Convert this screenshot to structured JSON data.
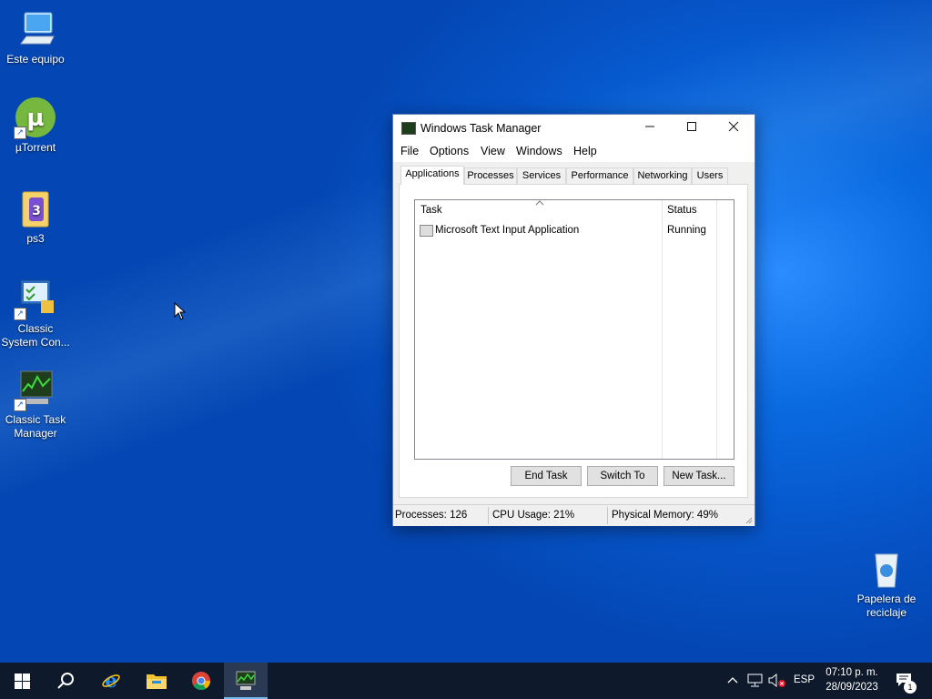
{
  "desktop": {
    "icons": [
      {
        "label": "Este equipo"
      },
      {
        "label": "µTorrent"
      },
      {
        "label": "ps3"
      },
      {
        "label": "Classic System Con..."
      },
      {
        "label": "Classic Task Manager"
      },
      {
        "label": "Papelera de reciclaje"
      }
    ]
  },
  "window": {
    "title": "Windows Task Manager",
    "menu": [
      "File",
      "Options",
      "View",
      "Windows",
      "Help"
    ],
    "tabs": [
      "Applications",
      "Processes",
      "Services",
      "Performance",
      "Networking",
      "Users"
    ],
    "active_tab": "Applications",
    "columns": {
      "task": "Task",
      "status": "Status"
    },
    "rows": [
      {
        "task": "Microsoft Text Input Application",
        "status": "Running"
      }
    ],
    "buttons": {
      "end_task": "End Task",
      "switch_to": "Switch To",
      "new_task": "New Task..."
    },
    "statusbar": {
      "processes": "Processes: 126",
      "cpu": "CPU Usage: 21%",
      "memory": "Physical Memory: 49%"
    }
  },
  "taskbar": {
    "items": [
      "start-icon",
      "search-icon",
      "internet-explorer-icon",
      "file-explorer-icon",
      "chrome-icon",
      "task-manager-icon"
    ],
    "tray": {
      "language": "ESP",
      "time": "07:10 p. m.",
      "date": "28/09/2023",
      "notification_count": "1"
    }
  },
  "colors": {
    "desktop": "#0654c8",
    "taskbar": "#0e1a2b",
    "accent": "#76b9ed"
  }
}
